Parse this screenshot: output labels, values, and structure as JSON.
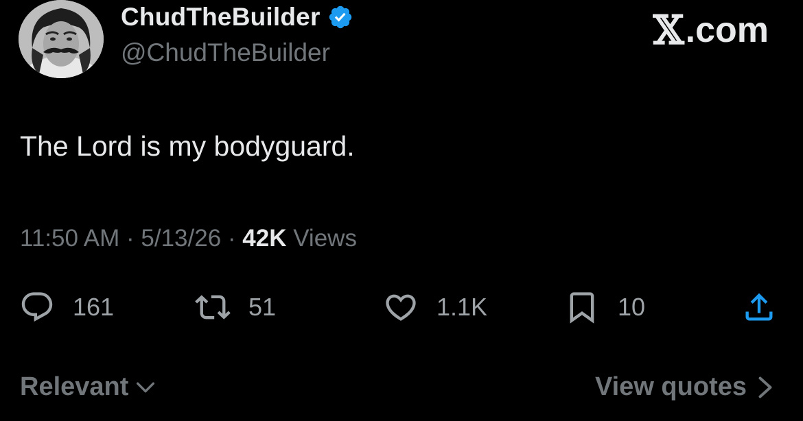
{
  "author": {
    "display_name": "ChudTheBuilder",
    "handle": "@ChudTheBuilder",
    "verified": true,
    "verified_color": "#1d9bf0"
  },
  "site": {
    "logo_icon": "x-logo-icon",
    "label": ".com"
  },
  "tweet": {
    "text": "The Lord is my bodyguard."
  },
  "meta": {
    "time": "11:50 AM",
    "sep1": " · ",
    "date": "5/13/26",
    "sep2": " · ",
    "views_count": "42K",
    "views_label": " Views"
  },
  "actions": {
    "reply": {
      "icon": "reply-icon",
      "count": "161"
    },
    "repost": {
      "icon": "repost-icon",
      "count": "51"
    },
    "like": {
      "icon": "heart-icon",
      "count": "1.1K"
    },
    "bookmark": {
      "icon": "bookmark-icon",
      "count": "10"
    },
    "share": {
      "icon": "share-icon"
    }
  },
  "footer": {
    "sort_label": "Relevant",
    "view_quotes_label": "View quotes"
  },
  "colors": {
    "background": "#000000",
    "text_primary": "#e7e9ea",
    "text_secondary": "#71767b"
  }
}
